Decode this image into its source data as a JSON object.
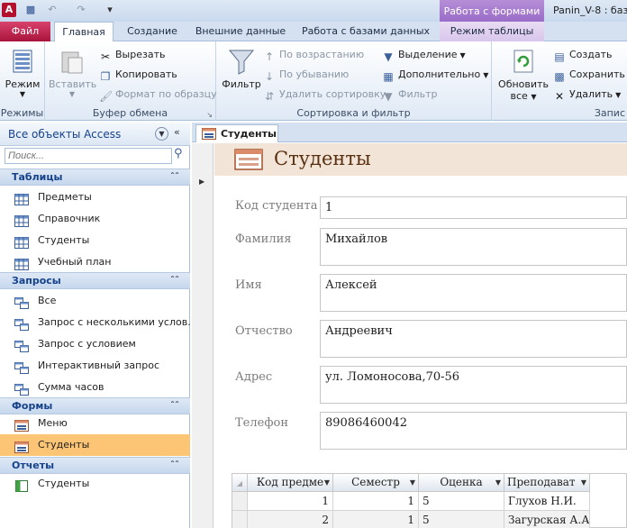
{
  "window": {
    "doc_title": "Panin_V-8 : баз",
    "context_tab": "Работа с формами"
  },
  "tabs": {
    "file": "Файл",
    "home": "Главная",
    "create": "Создание",
    "external": "Внешние данные",
    "db_tools": "Работа с базами данных",
    "table_mode": "Режим таблицы"
  },
  "ribbon": {
    "views": {
      "mode": "Режим",
      "group": "Режимы"
    },
    "clipboard": {
      "paste": "Вставить",
      "cut": "Вырезать",
      "copy": "Копировать",
      "format_painter": "Формат по образцу",
      "group": "Буфер обмена"
    },
    "sort": {
      "filter": "Фильтр",
      "asc": "По возрастанию",
      "desc": "По убыванию",
      "remove": "Удалить сортировку",
      "selection": "Выделение",
      "advanced": "Дополнительно",
      "toggle": "Фильтр",
      "group": "Сортировка и фильтр"
    },
    "records": {
      "refresh_line1": "Обновить",
      "refresh_line2": "все",
      "create": "Создать",
      "save": "Сохранить",
      "delete": "Удалить",
      "group": "Запис"
    }
  },
  "nav": {
    "title": "Все объекты Access",
    "search_placeholder": "Поиск...",
    "sections": {
      "tables": "Таблицы",
      "queries": "Запросы",
      "forms": "Формы",
      "reports": "Отчеты"
    },
    "tables": [
      "Предметы",
      "Справочник",
      "Студенты",
      "Учебный план"
    ],
    "queries": [
      "Все",
      "Запрос с несколькими услов...",
      "Запрос с условием",
      "Интерактивный запрос",
      "Сумма часов"
    ],
    "forms": [
      "Меню",
      "Студенты"
    ],
    "reports": [
      "Студенты"
    ]
  },
  "doc": {
    "tab": "Студенты",
    "form_title": "Студенты",
    "fields": {
      "id_label": "Код студента",
      "id_value": "1",
      "last_label": "Фамилия",
      "last_value": "Михайлов",
      "first_label": "Имя",
      "first_value": "Алексей",
      "middle_label": "Отчество",
      "middle_value": "Андреевич",
      "addr_label": "Адрес",
      "addr_value": "ул. Ломоносова,70-56",
      "phone_label": "Телефон",
      "phone_value": "89086460042"
    },
    "subform": {
      "headers": [
        "Код предме",
        "Семестр",
        "Оценка",
        "Преподават"
      ],
      "rows": [
        [
          "1",
          "1",
          "5",
          "Глухов Н.И."
        ],
        [
          "2",
          "1",
          "5",
          "Загурская А.А"
        ]
      ]
    }
  },
  "colors": {
    "file_tab": "#c0285a",
    "context": "#9a6cc8",
    "selected_nav": "#fcc575",
    "form_header": "#f2e4d6"
  }
}
